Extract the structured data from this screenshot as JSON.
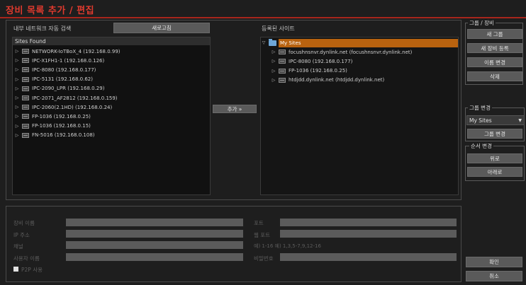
{
  "window": {
    "title": "장비 목록 추가 / 편집"
  },
  "left_panel": {
    "label": "내부 네트워크 자동 검색",
    "refresh_button": "새로고침",
    "header": "Sites Found",
    "items": [
      "NETWORK-IoTBoX_4 (192.168.0.99)",
      "IPC-X1FH1-1 (192.168.0.126)",
      "IPC-8080 (192.168.0.177)",
      "IPC-5131 (192.168.0.62)",
      "IPC-2090_LPR (192.168.0.29)",
      "IPC-2071_AF2812 (192.168.0.159)",
      "IPC-2060(2.1HD) (192.168.0.24)",
      "FP-1036 (192.168.0.25)",
      "FP-1036 (192.168.0.15)",
      "FN-5016 (192.168.0.108)"
    ]
  },
  "add_button": "추가 »",
  "right_panel": {
    "label": "등록된 사이트",
    "root": "My Sites",
    "items": [
      "focushnsnvr.dynlink.net (focushnsnvr.dynlink.net)",
      "IPC-8080 (192.168.0.177)",
      "FP-1036 (192.168.0.25)",
      "htdjdd.dynlink.net (htdjdd.dynlink.net)"
    ]
  },
  "form": {
    "device_name": "장비 이름",
    "ip_address": "IP 주소",
    "channel": "채널",
    "user_name": "사용자 이름",
    "p2p": "P2P 사용",
    "port": "포트",
    "web_port": "웹 포트",
    "channel_hint": "예) 1-16   예) 1,3,5-7,9,12-16",
    "password": "비밀번호"
  },
  "group_box": {
    "title": "그룹 / 장비",
    "new_group": "새 그룹",
    "new_device": "새 장비 등록",
    "rename": "이름 변경",
    "delete": "삭제"
  },
  "group_change": {
    "title": "그룹 변경",
    "selected": "My Sites",
    "apply": "그룹 변경"
  },
  "order_change": {
    "title": "순서 변경",
    "up": "위로",
    "down": "아래로"
  },
  "footer": {
    "ok": "확인",
    "cancel": "취소"
  },
  "colors": {
    "accent": "#e03a2e",
    "selection": "#b8620f",
    "button": "#5a5a5a"
  }
}
